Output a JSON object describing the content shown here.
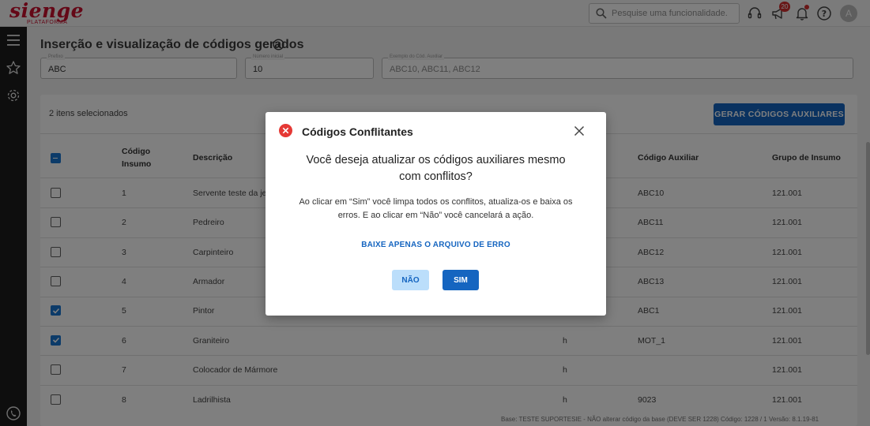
{
  "header": {
    "logo": "sienge",
    "logo_sub": "PLATAFORMA",
    "search_placeholder": "Pesquise uma funcionalidade.",
    "notification_count": "20",
    "avatar_initial": "A",
    "icons": [
      "search-icon",
      "headset-icon",
      "megaphone-icon",
      "bell-icon",
      "help-icon"
    ]
  },
  "sidebar": {
    "icons": [
      "menu-icon",
      "star-icon",
      "gear-icon",
      "whatsapp-icon"
    ]
  },
  "page": {
    "title": "Inserção e visualização de códigos gerados"
  },
  "form": {
    "prefix_label": "Prefixo",
    "prefix_value": "ABC",
    "start_label": "Número inicial",
    "start_value": "10",
    "example_label": "Exemplo do Cód. Auxiliar",
    "example_value": "ABC10, ABC11, ABC12"
  },
  "table": {
    "selected_count": "2 itens selecionados",
    "generate_button": "GERAR CÓDIGOS AUXILIARES",
    "headers": {
      "code_line1": "Código",
      "code_line2": "Insumo",
      "description": "Descrição",
      "aux_code": "Código Auxiliar",
      "group": "Grupo de Insumo"
    },
    "rows": [
      {
        "checked": false,
        "code": "1",
        "desc": "Servente teste da je",
        "unit": "",
        "aux": "ABC10",
        "group": "121.001"
      },
      {
        "checked": false,
        "code": "2",
        "desc": "Pedreiro",
        "unit": "",
        "aux": "ABC11",
        "group": "121.001"
      },
      {
        "checked": false,
        "code": "3",
        "desc": "Carpinteiro",
        "unit": "",
        "aux": "ABC12",
        "group": "121.001"
      },
      {
        "checked": false,
        "code": "4",
        "desc": "Armador",
        "unit": "",
        "aux": "ABC13",
        "group": "121.001"
      },
      {
        "checked": true,
        "code": "5",
        "desc": "Pintor",
        "unit": "",
        "aux": "ABC1",
        "group": "121.001"
      },
      {
        "checked": true,
        "code": "6",
        "desc": "Graniteiro",
        "unit": "h",
        "aux": "MOT_1",
        "group": "121.001"
      },
      {
        "checked": false,
        "code": "7",
        "desc": "Colocador de Mármore",
        "unit": "h",
        "aux": "",
        "group": "121.001"
      },
      {
        "checked": false,
        "code": "8",
        "desc": "Ladrilhista",
        "unit": "h",
        "aux": "9023",
        "group": "121.001"
      }
    ]
  },
  "footer": {
    "text": "Base: TESTE SUPORTESIE - NÃO alterar código da base (DEVE SER 1228)  Código: 1228 / 1  Versão: 8.1.19-81"
  },
  "modal": {
    "title": "Códigos Conflitantes",
    "question": "Você deseja atualizar os códigos auxiliares mesmo com conflitos?",
    "body": "Ao clicar em “Sim” você limpa todos os conflitos, atualiza-os e baixa os erros. E ao clicar em “Não” você cancelará a ação.",
    "link": "BAIXE APENAS O ARQUIVO DE ERRO",
    "no_button": "NÃO",
    "yes_button": "SIM"
  },
  "colors": {
    "brand": "#c8102e",
    "primary": "#1565c0",
    "sidebar": "#1d1d1d",
    "error": "#e53935"
  }
}
